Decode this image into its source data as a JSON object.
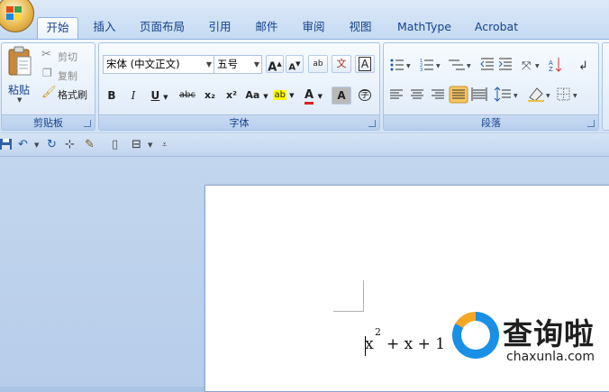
{
  "tabs": [
    "开始",
    "插入",
    "页面布局",
    "引用",
    "邮件",
    "审阅",
    "视图",
    "MathType",
    "Acrobat"
  ],
  "clipboard": {
    "paste": "粘贴",
    "cut": "剪切",
    "copy": "复制",
    "format_painter": "格式刷",
    "group_label": "剪贴板"
  },
  "font": {
    "font_name": "宋体 (中文正文)",
    "font_size": "五号",
    "grow": "A",
    "shrink": "A",
    "bold": "B",
    "italic": "I",
    "underline": "U",
    "strike": "abc",
    "subscript": "x₂",
    "superscript": "x²",
    "change_case": "Aa",
    "highlight": "ab",
    "font_color": "A",
    "char_shading": "A",
    "enclose": "字",
    "phonetic": "文",
    "char_border": "A",
    "clear_format": "ab",
    "group_label": "字体"
  },
  "paragraph": {
    "group_label": "段落"
  },
  "equation": {
    "base": "x",
    "exponent": "2",
    "rest": "+ x + 1"
  },
  "watermark": {
    "title": "查询啦",
    "domain": "chaxunla.com"
  },
  "colors": {
    "accent": "#15428b",
    "highlight": "#ffff00",
    "font_color": "#e02020",
    "selected": "#f8c660"
  }
}
